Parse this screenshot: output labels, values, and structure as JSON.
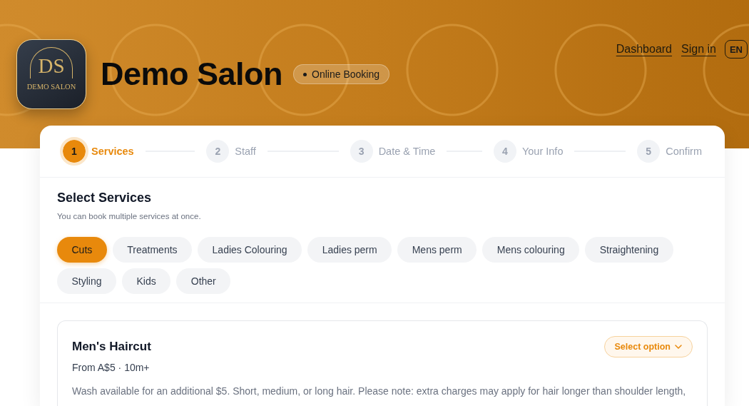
{
  "header": {
    "logo": {
      "monogram": "DS",
      "caption": "DEMO SALON"
    },
    "title": "Demo Salon",
    "badge": "Online Booking",
    "links": [
      "Dashboard",
      "Sign in"
    ],
    "language": "EN"
  },
  "steps": [
    {
      "number": "1",
      "label": "Services",
      "selected": true
    },
    {
      "number": "2",
      "label": "Staff",
      "selected": false
    },
    {
      "number": "3",
      "label": "Date & Time",
      "selected": false
    },
    {
      "number": "4",
      "label": "Your Info",
      "selected": false
    },
    {
      "number": "5",
      "label": "Confirm",
      "selected": false
    }
  ],
  "services": {
    "title": "Select Services",
    "subtitle": "You can book multiple services at once.",
    "categories": [
      {
        "label": "Cuts",
        "selected": true
      },
      {
        "label": "Treatments",
        "selected": false
      },
      {
        "label": "Ladies Colouring",
        "selected": false
      },
      {
        "label": "Ladies perm",
        "selected": false
      },
      {
        "label": "Mens perm",
        "selected": false
      },
      {
        "label": "Mens colouring",
        "selected": false
      },
      {
        "label": "Straightening",
        "selected": false
      },
      {
        "label": "Styling",
        "selected": false
      },
      {
        "label": "Kids",
        "selected": false
      },
      {
        "label": "Other",
        "selected": false
      }
    ]
  },
  "service_list": [
    {
      "name": "Men's Haircut",
      "meta": "From A$5 · 10m+",
      "description": "Wash available for an additional $5. Short, medium, or long hair. Please note: extra charges may apply for hair longer than shoulder length,",
      "action": "Select option"
    }
  ]
}
